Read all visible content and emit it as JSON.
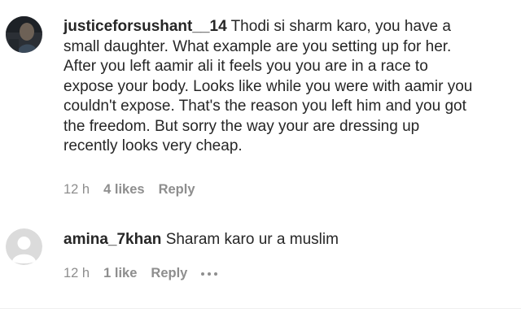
{
  "comments": [
    {
      "username": "justiceforsushant__14",
      "text": "Thodi si sharm karo, you have a\nsmall daughter. What example are you setting up for her.\nAfter you left aamir ali it feels you you are in a race to\nexpose your body. Looks like while you were with aamir you\ncouldn't expose. That's the reason you left him and you got\nthe freedom. But sorry the way your are dressing up\nrecently looks very cheap.",
      "time": "12 h",
      "likes": "4 likes",
      "reply": "Reply"
    },
    {
      "username": "amina_7khan",
      "text": "Sharam karo ur a muslim",
      "time": "12 h",
      "likes": "1 like",
      "reply": "Reply"
    }
  ]
}
